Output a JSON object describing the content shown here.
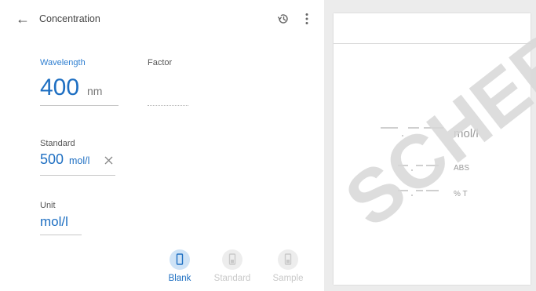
{
  "header": {
    "title": "Concentration"
  },
  "wavelength": {
    "label": "Wavelength",
    "value": "400",
    "unit": "nm"
  },
  "factor": {
    "label": "Factor"
  },
  "standard": {
    "label": "Standard",
    "value": "500",
    "unit": "mol/l"
  },
  "unit_field": {
    "label": "Unit",
    "value": "mol/l"
  },
  "tabs": [
    {
      "label": "Blank",
      "active": true
    },
    {
      "label": "Standard",
      "active": false
    },
    {
      "label": "Sample",
      "active": false
    }
  ],
  "result": {
    "main_unit": "mol/l",
    "abs_unit": "ABS",
    "t_unit": "% T"
  },
  "colors": {
    "accent": "#1e6fc2",
    "accent_light": "#cfe3f6",
    "inactive": "#c9c9c9"
  },
  "icons": [
    "arrow-back-icon",
    "history-icon",
    "more-vert-icon",
    "close-icon",
    "cuvette-icon"
  ],
  "watermark": "SCHER"
}
